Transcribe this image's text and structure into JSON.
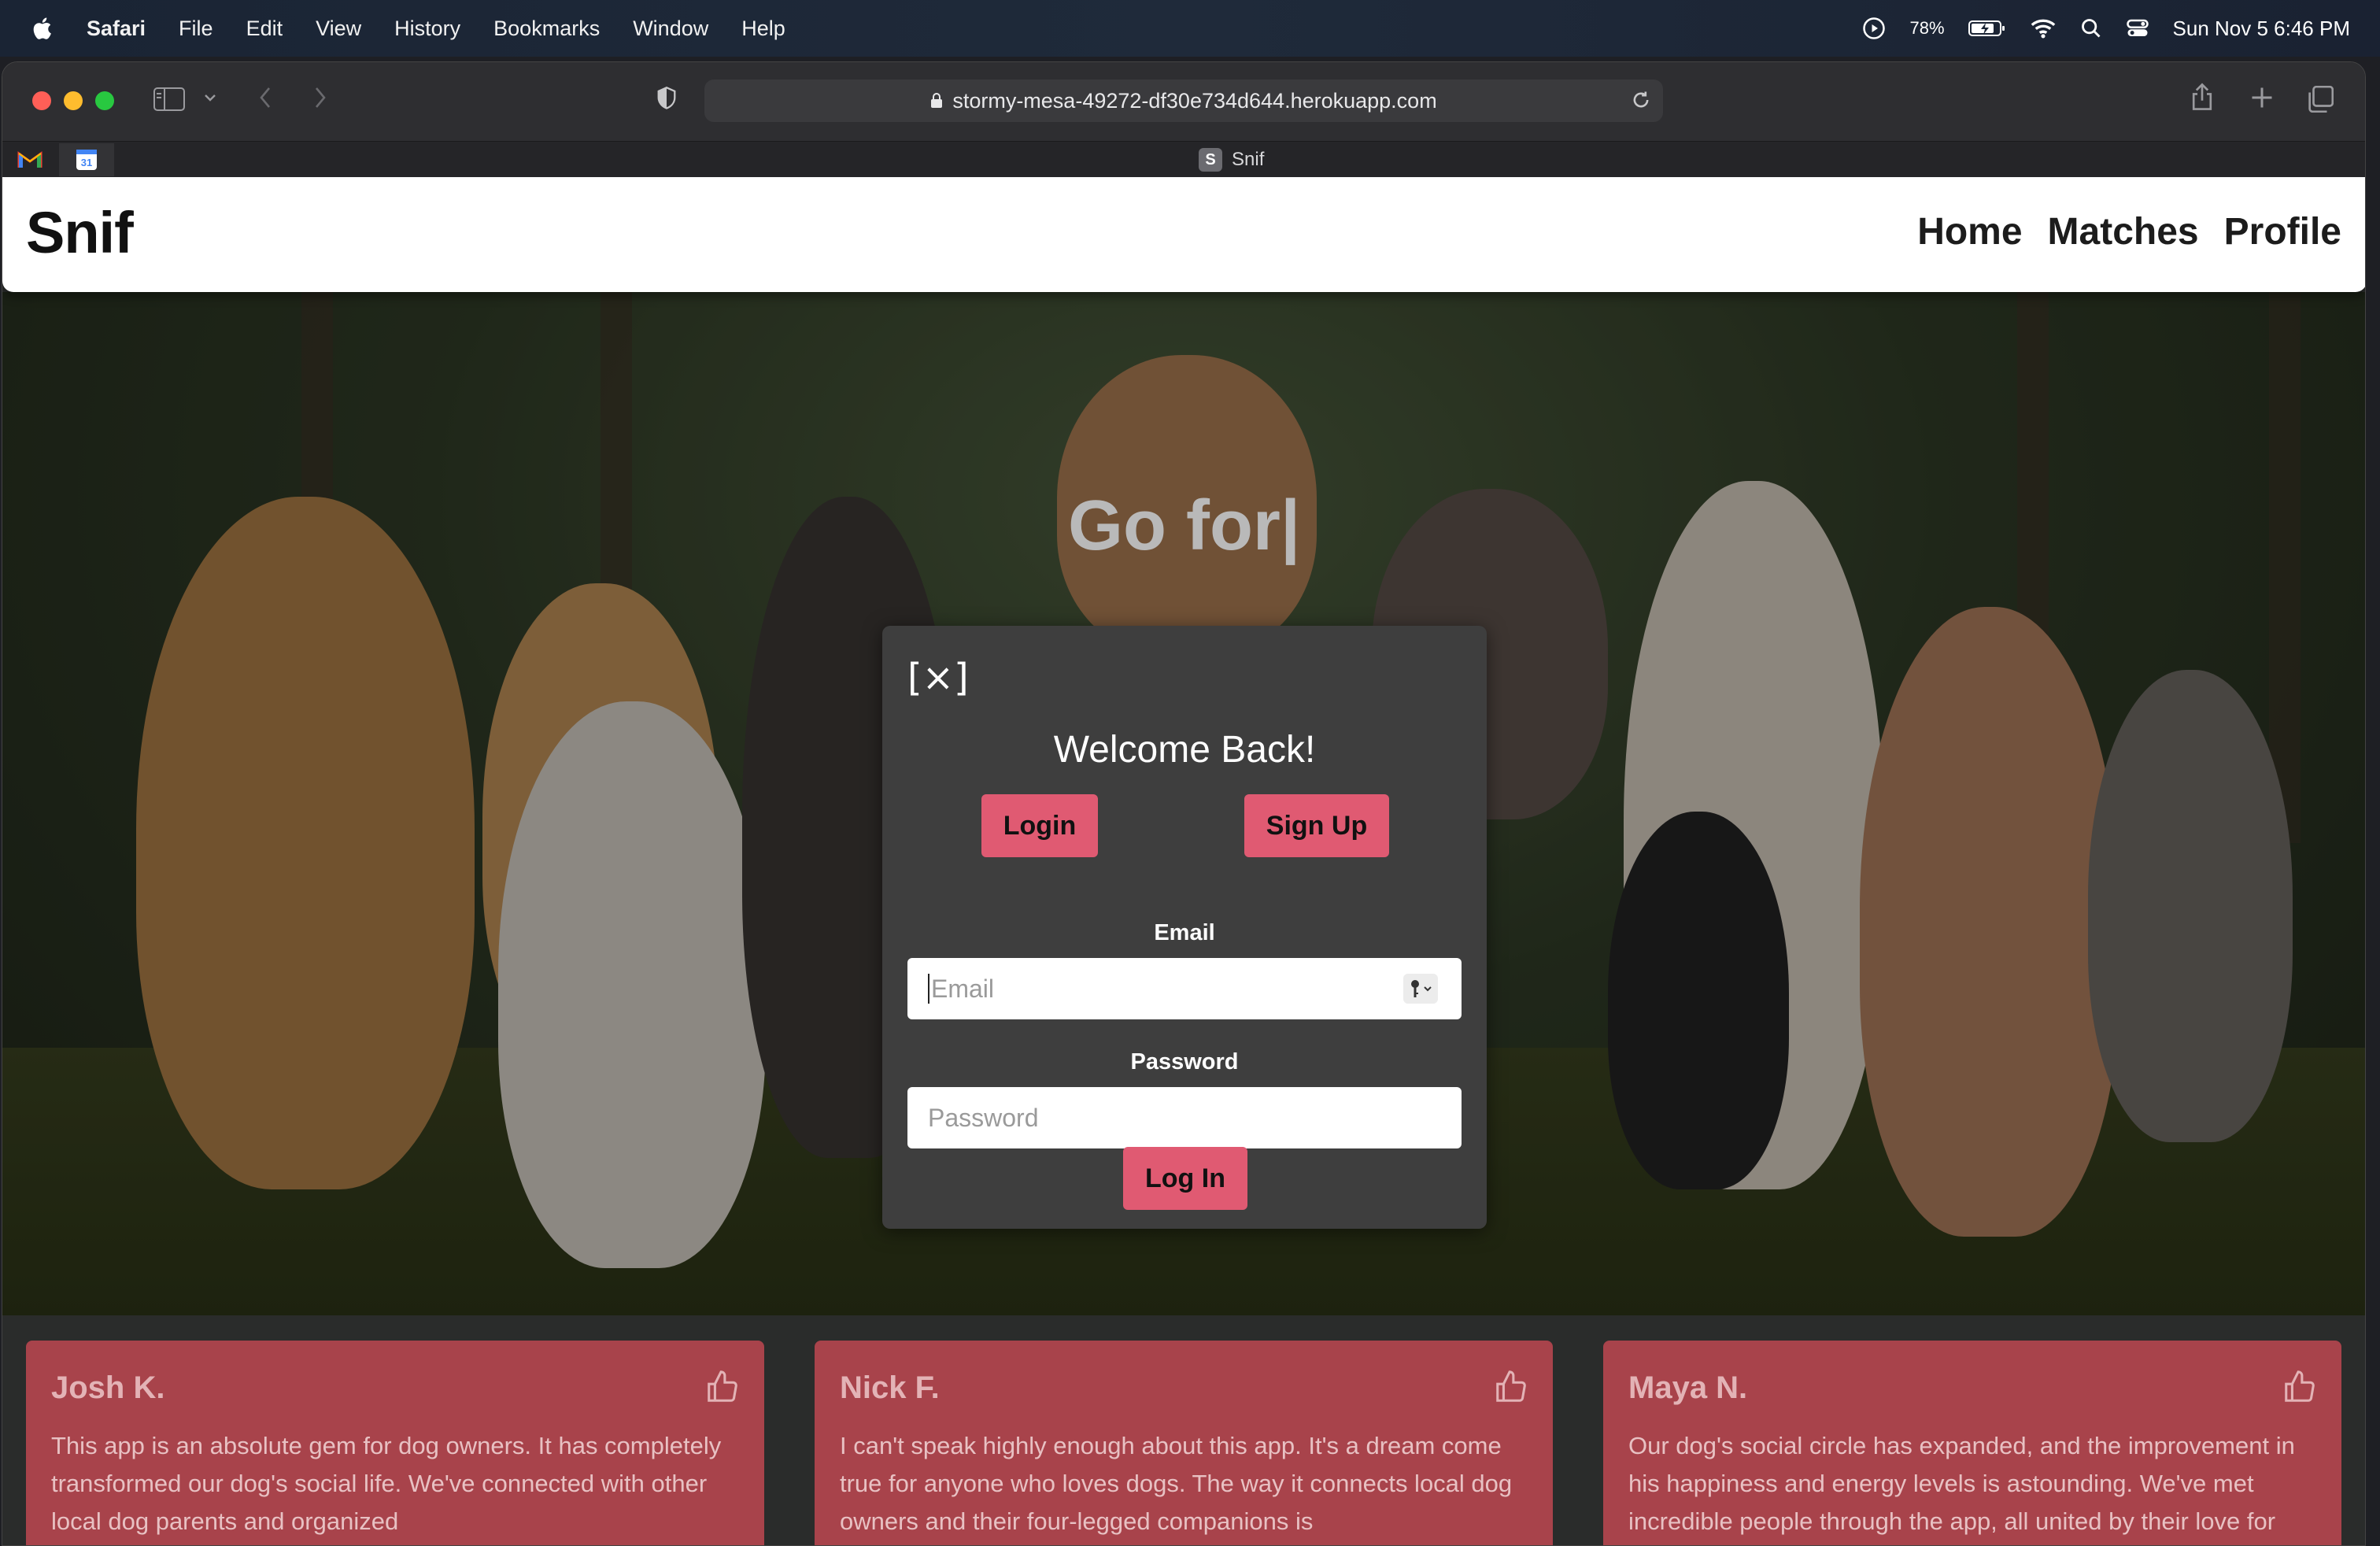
{
  "menubar": {
    "app_name": "Safari",
    "items": [
      "File",
      "Edit",
      "View",
      "History",
      "Bookmarks",
      "Window",
      "Help"
    ],
    "battery": "78%",
    "datetime": "Sun Nov 5  6:46 PM"
  },
  "browser": {
    "url": "stormy-mesa-49272-df30e734d644.herokuapp.com",
    "tab_title": "Snif",
    "tab_badge": "S",
    "calendar_day": "31"
  },
  "site": {
    "brand": "Snif",
    "nav": [
      "Home",
      "Matches",
      "Profile"
    ],
    "hero_title": "Go for|"
  },
  "modal": {
    "close_label": "[×]",
    "title": "Welcome Back!",
    "login_tab": "Login",
    "signup_tab": "Sign Up",
    "email_label": "Email",
    "email_placeholder": "Email",
    "password_label": "Password",
    "password_placeholder": "Password",
    "submit": "Log In"
  },
  "testimonials": [
    {
      "name": "Josh K.",
      "text": "This app is an absolute gem for dog owners. It has completely transformed our dog's social life. We've connected with other local dog parents and organized"
    },
    {
      "name": "Nick F.",
      "text": "I can't speak highly enough about this app. It's a dream come true for anyone who loves dogs. The way it connects local dog owners and their four-legged companions is"
    },
    {
      "name": "Maya N.",
      "text": "Our dog's social circle has expanded, and the improvement in his happiness and energy levels is astounding. We've met incredible people through the app, all united by their love for"
    }
  ],
  "colors": {
    "accent": "#e05a72",
    "card_bg": "#a8434b",
    "modal_bg": "#3e3e3e"
  }
}
